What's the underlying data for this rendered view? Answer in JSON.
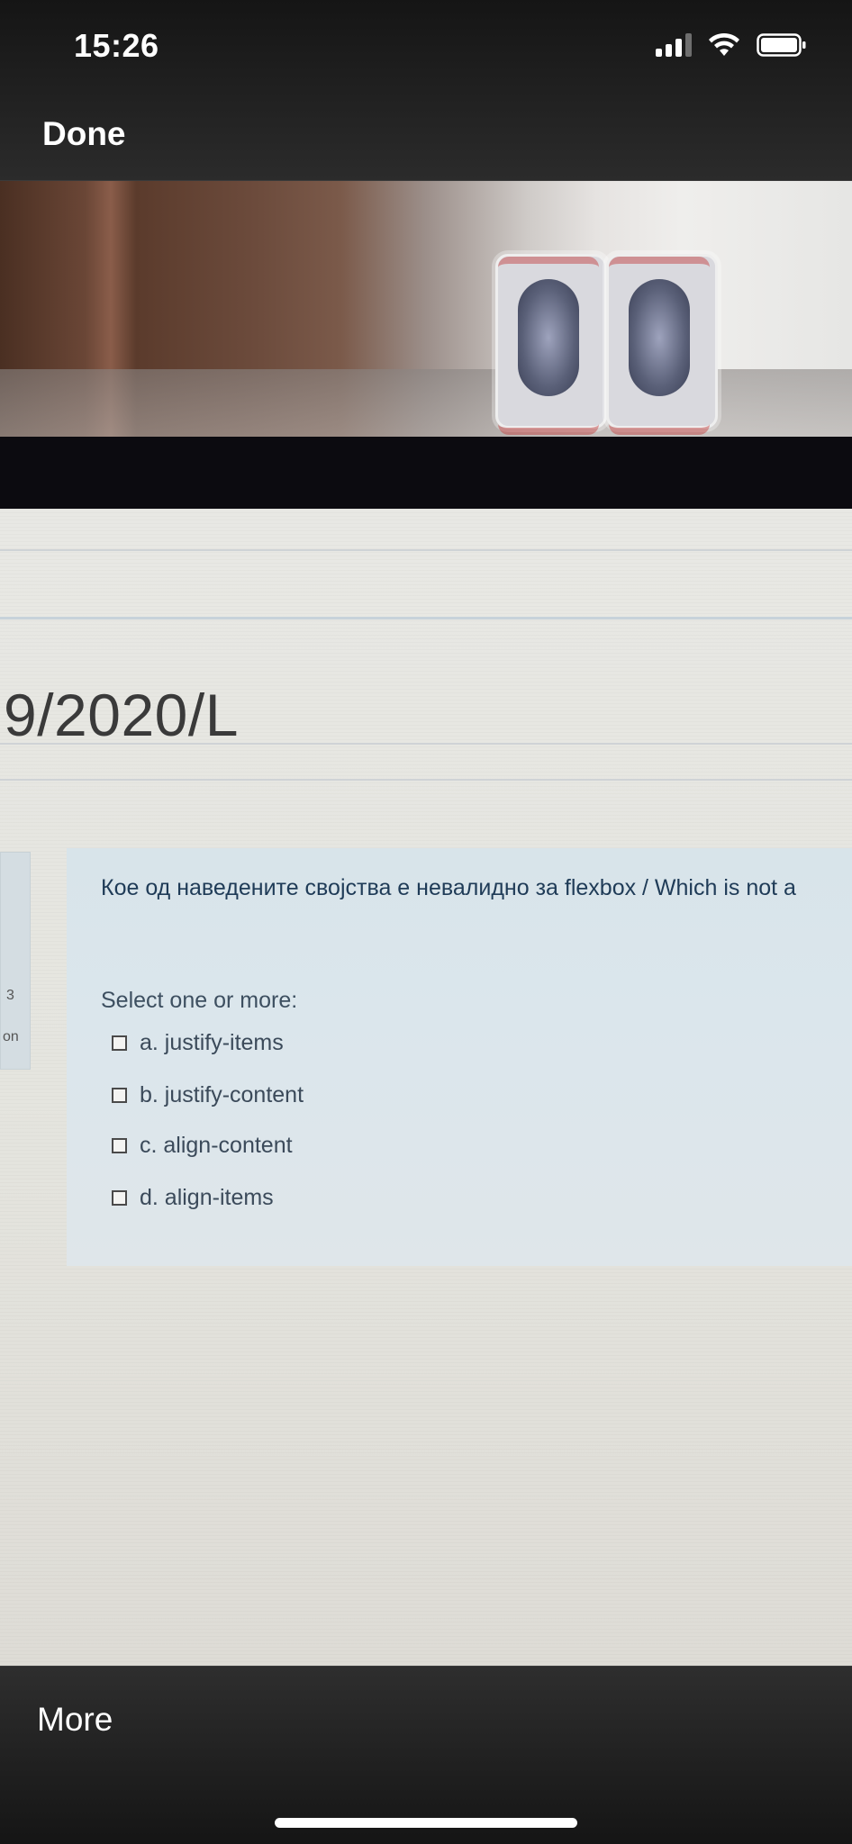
{
  "status_bar": {
    "time": "15:26",
    "icons": [
      "cellular-signal-icon",
      "wifi-icon",
      "battery-icon"
    ]
  },
  "nav": {
    "done_label": "Done"
  },
  "photo": {
    "course_title": "9/2020/L",
    "side_panel": {
      "fragment_1": "3",
      "fragment_2": "on"
    },
    "question": {
      "text": "Кое од наведените својства е невалидно за flexbox / Which is not a",
      "select_hint": "Select one or more:",
      "options": [
        {
          "label": "a. justify-items",
          "checked": false
        },
        {
          "label": "b. justify-content",
          "checked": false
        },
        {
          "label": "c. align-content",
          "checked": false
        },
        {
          "label": "d. align-items",
          "checked": false
        }
      ]
    },
    "colors": {
      "question_bg": "#dbe6ec",
      "question_text": "#1f3b57",
      "screen_bg": "#e4e4df"
    }
  },
  "toolbar": {
    "more_label": "More"
  }
}
